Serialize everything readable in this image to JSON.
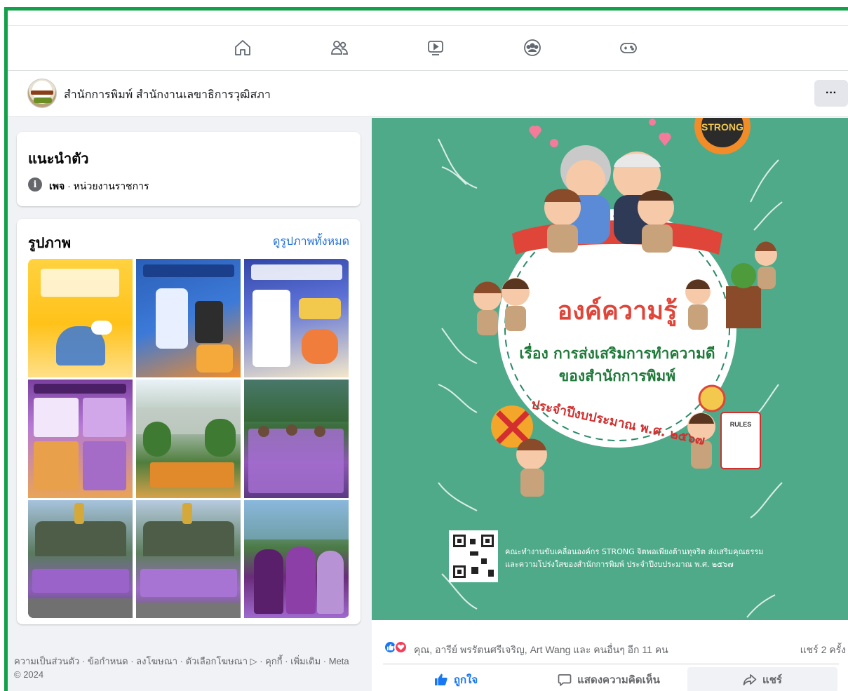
{
  "nav": {
    "icons": [
      "home-icon",
      "friends-icon",
      "video-icon",
      "groups-icon",
      "gaming-icon"
    ]
  },
  "page": {
    "name": "สำนักการพิมพ์ สำนักงานเลขาธิการวุฒิสภา",
    "more_label": "···"
  },
  "intro": {
    "title": "แนะนำตัว",
    "category_label": "เพจ",
    "category_value": " · หน่วยงานราชการ"
  },
  "photos": {
    "title": "รูปภาพ",
    "see_all": "ดูรูปภาพทั้งหมด"
  },
  "footer": {
    "text": "ความเป็นส่วนตัว · ข้อกำหนด · ลงโฆษณา · ตัวเลือกโฆษณา ▷ · คุกกี้ · เพิ่มเติม · Meta © 2024"
  },
  "post": {
    "poster_text": {
      "heading": "องค์ความรู้",
      "subtitle_1": "เรื่อง การส่งเสริมการทำความดี",
      "subtitle_2": "ของสำนักการพิมพ์",
      "year_arc": "ประจำปีงบประมาณ พ.ศ. ๒๕๖๗",
      "caption_1": "คณะทำงานขับเคลื่อนองค์กร STRONG จิตพอเพียงต้านทุจริต ส่งเสริมคุณธรรม",
      "caption_2": "และความโปร่งใสของสำนักการพิมพ์ ประจำปีงบประมาณ พ.ศ. ๒๕๖๗",
      "badge": "STRONG",
      "checklist_title": "RULES"
    },
    "reactions_text": "คุณ, อารีย์ พรรัตนศรีเจริญ, Art Wang และ คนอื่นๆ อีก 11 คน",
    "share_count": "แชร์ 2 ครั้ง",
    "actions": {
      "like": "ถูกใจ",
      "comment": "แสดงความคิดเห็น",
      "share": "แชร์"
    }
  },
  "colors": {
    "frame_border": "#12a14a",
    "facebook_blue": "#1877f2",
    "link_blue": "#216fdb",
    "poster_background": "#4faa8a",
    "poster_heading": "#e0453a",
    "poster_subtitle": "#1f7a3a"
  }
}
